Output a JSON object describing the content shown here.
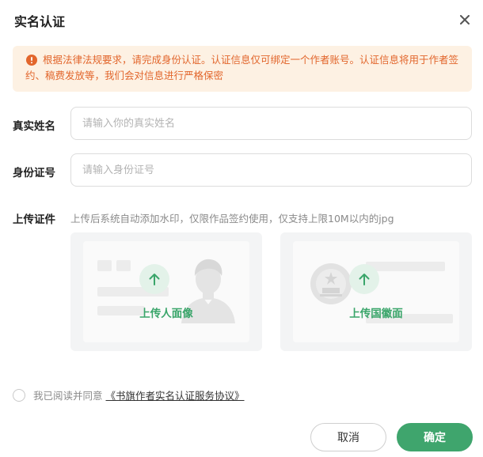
{
  "dialog": {
    "title": "实名认证"
  },
  "notice": {
    "text": "根据法律法规要求，请完成身份认证。认证信息仅可绑定一个作者账号。认证信息将用于作者签约、稿费发放等，我们会对信息进行严格保密"
  },
  "form": {
    "name": {
      "label": "真实姓名",
      "placeholder": "请输入你的真实姓名",
      "value": ""
    },
    "id_number": {
      "label": "身份证号",
      "placeholder": "请输入身份证号",
      "value": ""
    },
    "upload": {
      "label": "上传证件",
      "hint": "上传后系统自动添加水印，仅限作品签约使用，仅支持上限10M以内的jpg",
      "portrait_label": "上传人面像",
      "emblem_label": "上传国徽面"
    }
  },
  "agreement": {
    "prefix": "我已阅读并同意",
    "link": "《书旗作者实名认证服务协议》"
  },
  "buttons": {
    "cancel": "取消",
    "confirm": "确定"
  },
  "colors": {
    "accent": "#3fa56d",
    "warning_text": "#e2662c",
    "warning_bg": "#fdf1e3"
  }
}
